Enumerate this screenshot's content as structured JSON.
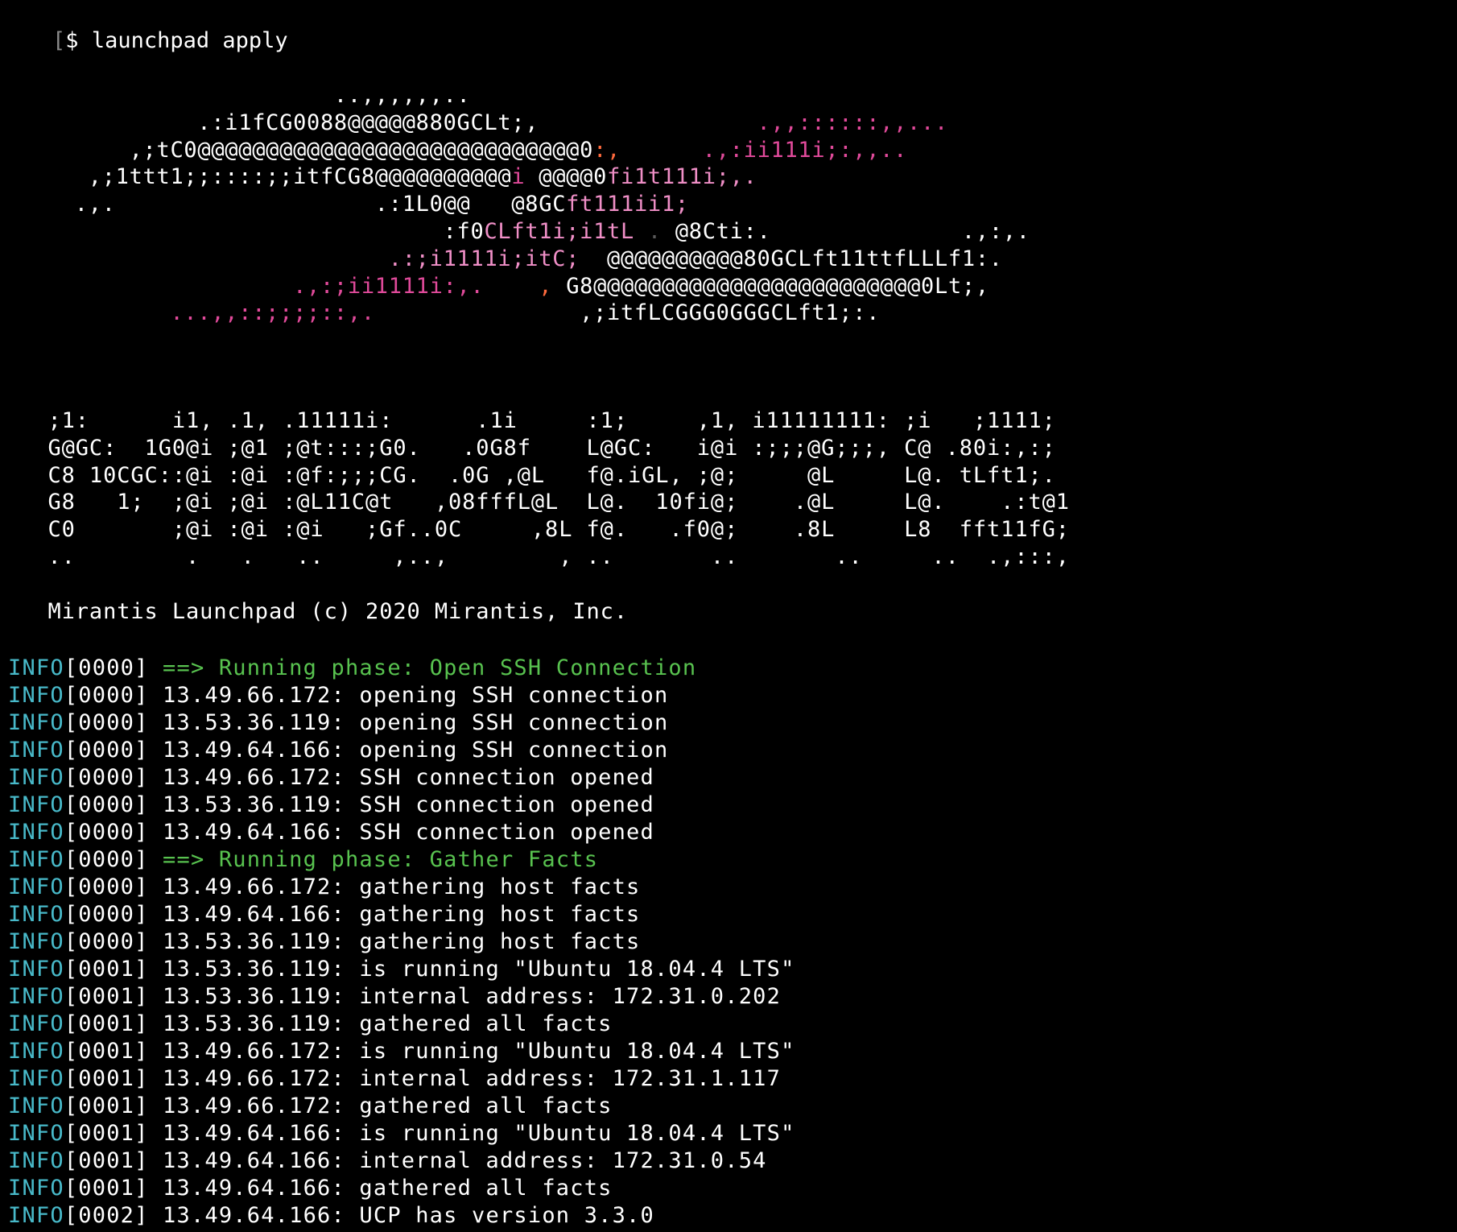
{
  "window": {
    "background": "#000000",
    "colors": {
      "info_tag": "#48b9c9",
      "phase_text": "#58c24f",
      "text": "#ffffff",
      "art_pink": "#e04a9a",
      "art_pink_light": "#f08fc7",
      "art_orange": "#ff6a3d"
    }
  },
  "prompt": {
    "bracket": "[",
    "symbol": "$",
    "command": "launchpad apply"
  },
  "ascii_art": [
    [
      [
        "w",
        "                        ..,,,,,,.."
      ]
    ],
    [
      [
        "w",
        "              .:i1fCG0088@@@@@880GCLt;,"
      ],
      [
        "p",
        "                .,,::::::,,..."
      ]
    ],
    [
      [
        "w",
        "         ,;tC0@@@@@@@@@@@@@@@@@@@@@@@@@@@@0"
      ],
      [
        "o",
        ":,"
      ],
      [
        "p",
        "      .,:ii111i;:,,.."
      ]
    ],
    [
      [
        "w",
        "      ,;1ttt1;;::::;;itfCG8@@@@@@@@@@"
      ],
      [
        "p",
        "i"
      ],
      [
        "w",
        " @@@@0"
      ],
      [
        "pl",
        "fi1t111i;,."
      ]
    ],
    [
      [
        "w",
        "     .,.                   .:1L0@@   @8GC"
      ],
      [
        "pl",
        "ft111ii1;"
      ]
    ],
    [
      [
        "w",
        "                                :f0"
      ],
      [
        "pl",
        "CLft1i;i1tL"
      ],
      [
        "dg",
        " . "
      ],
      [
        "w",
        "@8Cti:."
      ],
      [
        "w",
        "              .,:,."
      ]
    ],
    [
      [
        "pl",
        "                            .:;i1111i;itC;"
      ],
      [
        "w",
        "  @@@@@@@@@@80GCLft11ttfLLLf1:."
      ]
    ],
    [
      [
        "p",
        "                     .,:;ii1111i:,."
      ],
      [
        "w",
        "    "
      ],
      [
        "o",
        ","
      ],
      [
        "w",
        " G8@@@@@@@@@@@@@@@@@@@@@@@@0Lt;,"
      ]
    ],
    [
      [
        "p",
        "            ...,,::;;;;::,."
      ],
      [
        "w",
        "               ,;itfLCGGG0GGGCLft1;:."
      ]
    ]
  ],
  "logo_text": [
    "   ;1:      i1, .1, .11111i:      .1i     :1;     ,1, i11111111: ;i   ;1111;",
    "   G@GC:  1G0@i ;@1 ;@t:::;G0.   .0G8f    L@GC:   i@i :;;;@G;;;, C@ .80i:,:;",
    "   C8 10CGC::@i :@i :@f:;;;CG.  .0G ,@L   f@.iGL, ;@;     @L     L@. tLft1;.",
    "   G8   1;  ;@i ;@i :@L11C@t   ,08fffL@L  L@.  10fi@;    .@L     L@.    .:t@1",
    "   C0       ;@i :@i :@i   ;Gf..0C     ,8L f@.   .f0@;    .8L     L8  fft11fG;",
    "   ..        .   .   ..     ,..,        , ..       ..       ..     ..  .,:::,"
  ],
  "copyright": "   Mirantis Launchpad (c) 2020 Mirantis, Inc.",
  "log_lines": [
    {
      "tag": "INFO",
      "stamp": "[0000]",
      "msg": "==> Running phase: Open SSH Connection",
      "phase": true
    },
    {
      "tag": "INFO",
      "stamp": "[0000]",
      "msg": "13.49.66.172: opening SSH connection",
      "phase": false
    },
    {
      "tag": "INFO",
      "stamp": "[0000]",
      "msg": "13.53.36.119: opening SSH connection",
      "phase": false
    },
    {
      "tag": "INFO",
      "stamp": "[0000]",
      "msg": "13.49.64.166: opening SSH connection",
      "phase": false
    },
    {
      "tag": "INFO",
      "stamp": "[0000]",
      "msg": "13.49.66.172: SSH connection opened",
      "phase": false
    },
    {
      "tag": "INFO",
      "stamp": "[0000]",
      "msg": "13.53.36.119: SSH connection opened",
      "phase": false
    },
    {
      "tag": "INFO",
      "stamp": "[0000]",
      "msg": "13.49.64.166: SSH connection opened",
      "phase": false
    },
    {
      "tag": "INFO",
      "stamp": "[0000]",
      "msg": "==> Running phase: Gather Facts",
      "phase": true
    },
    {
      "tag": "INFO",
      "stamp": "[0000]",
      "msg": "13.49.66.172: gathering host facts",
      "phase": false
    },
    {
      "tag": "INFO",
      "stamp": "[0000]",
      "msg": "13.49.64.166: gathering host facts",
      "phase": false
    },
    {
      "tag": "INFO",
      "stamp": "[0000]",
      "msg": "13.53.36.119: gathering host facts",
      "phase": false
    },
    {
      "tag": "INFO",
      "stamp": "[0001]",
      "msg": "13.53.36.119: is running \"Ubuntu 18.04.4 LTS\"",
      "phase": false
    },
    {
      "tag": "INFO",
      "stamp": "[0001]",
      "msg": "13.53.36.119: internal address: 172.31.0.202",
      "phase": false
    },
    {
      "tag": "INFO",
      "stamp": "[0001]",
      "msg": "13.53.36.119: gathered all facts",
      "phase": false
    },
    {
      "tag": "INFO",
      "stamp": "[0001]",
      "msg": "13.49.66.172: is running \"Ubuntu 18.04.4 LTS\"",
      "phase": false
    },
    {
      "tag": "INFO",
      "stamp": "[0001]",
      "msg": "13.49.66.172: internal address: 172.31.1.117",
      "phase": false
    },
    {
      "tag": "INFO",
      "stamp": "[0001]",
      "msg": "13.49.66.172: gathered all facts",
      "phase": false
    },
    {
      "tag": "INFO",
      "stamp": "[0001]",
      "msg": "13.49.64.166: is running \"Ubuntu 18.04.4 LTS\"",
      "phase": false
    },
    {
      "tag": "INFO",
      "stamp": "[0001]",
      "msg": "13.49.64.166: internal address: 172.31.0.54",
      "phase": false
    },
    {
      "tag": "INFO",
      "stamp": "[0001]",
      "msg": "13.49.64.166: gathered all facts",
      "phase": false
    },
    {
      "tag": "INFO",
      "stamp": "[0002]",
      "msg": "13.49.64.166: UCP has version 3.3.0",
      "phase": false
    }
  ]
}
